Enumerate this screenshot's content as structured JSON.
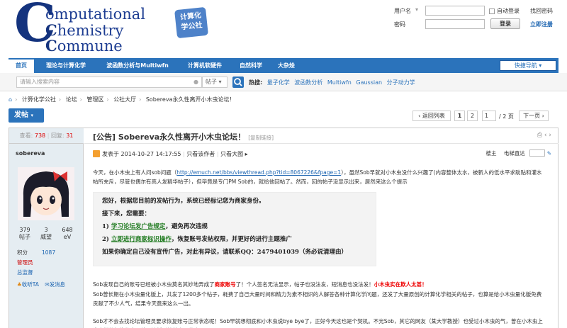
{
  "logo": {
    "line1_initial": "C",
    "line1_rest": "omputational",
    "line2_initial": "C",
    "line2_rest": "hemistry",
    "line3_initial": "C",
    "line3_rest": "ommune",
    "badge_line1": "计算化",
    "badge_line2": "学公社"
  },
  "login": {
    "username_label": "用户名",
    "password_label": "密码",
    "auto_login": "自动登录",
    "forgot_password": "找回密码",
    "login_button": "登录",
    "register": "立即注册"
  },
  "nav": {
    "items": [
      "首页",
      "理论与计算化学",
      "波函数分析与Multiwfn",
      "计算机软硬件",
      "自然科学",
      "大杂烩"
    ],
    "quick_nav": "快捷导航"
  },
  "search": {
    "placeholder": "请输入搜索内容",
    "type": "帖子",
    "hot_label": "热搜:",
    "hot_items": [
      "量子化学",
      "波函数分析",
      "Multiwfn",
      "Gaussian",
      "分子动力学"
    ]
  },
  "breadcrumb": [
    "计算化学公社",
    "论坛",
    "管理区",
    "公社大厅",
    "Sobereva永久性离开小木虫论坛！"
  ],
  "toolbar": {
    "post_button": "发帖",
    "back_list": "返回列表",
    "page1": "1",
    "page2": "2",
    "page_input": "1",
    "page_total": "/ 2 页",
    "next_page": "下一页"
  },
  "thread": {
    "views_label": "查看:",
    "views": "738",
    "replies_label": "回复:",
    "replies": "31",
    "title": "[公告] Sobereva永久性离开小木虫论坛！",
    "copy_link": "[复制链接]"
  },
  "author": {
    "name": "sobereva",
    "stats": [
      {
        "value": "379",
        "label": "帖子"
      },
      {
        "value": "3",
        "label": "威望"
      },
      {
        "value": "648",
        "label": "eV"
      }
    ],
    "points_label": "积分",
    "points": "1087",
    "role": "管理员",
    "role2": "总监督",
    "favorite_ta": "收听TA",
    "message": "发消息"
  },
  "post": {
    "meta_prefix": "发表于",
    "datetime": "2014-10-27 14:17:55",
    "only_author": "只看该作者",
    "only_big": "只看大图",
    "floor": "楼主",
    "font_size_label": "电梯直达",
    "p1_a": "今天，在小木虫上有人问sob问题（",
    "p1_link": "http://emuch.net/bbs/viewthread.php?tid=8067226&fpage=1",
    "p1_b": "），虽然Sob早就对小木虫没什么兴趣了(内容整体太水，被新人的低水平求助贴和灌水帖所充斥，尽管也偶尔有高人发精华帖子），但毕竟是专门PM Sob的，就给他回帖了。然而，回的帖子没显示出来，居然来这么个提示",
    "notice_1": "您好，根据您目前的发帖行为，系统已经标记您为商家身份。",
    "notice_2": "接下来，您需要：",
    "notice_3_num": "1) ",
    "notice_3_link": "学习论坛发广告规定",
    "notice_3_rest": "，避免再次违规",
    "notice_4_num": "2) ",
    "notice_4_link": "立即进行商家标识操作",
    "notice_4_rest": "，恢复账号发帖权限，并更好的进行主题推广",
    "notice_5": "如果你确定自己没有宣传广告，对此有异议，请联系QQ：2479401039（务必说清理由）",
    "p2_a": "Sob发现自己的账号已经被小木虫莫名其妙地弄成了",
    "p2_red1": "商家账号",
    "p2_b": "了！个人签名无法显示，帖子也没法发，短消息也没法发！",
    "p2_red2": "小木虫实在欺人太甚！",
    "p3": "Sob曾长期在小木虫量化版上，共发了1200多个帖子，耗费了自己大量时间和精力为素不相识的人解答各种计算化学问题，还发了大量原创的计算化学相关的帖子，也算是给小木虫量化版免费贡献了不少人气，结果今天竟来这么一出。",
    "p4": "Sob才不会去找论坛管理员要求恢复账号正常状态呢！Sob早就想彻底和小木虫说bye bye了，正好今天这也是个契机。不光Sob，其它的网友（某大学教授）也受过小木虫的气，曾在小木虫上发本学校招生信息，结果被暂时性禁言，他表示"
  }
}
